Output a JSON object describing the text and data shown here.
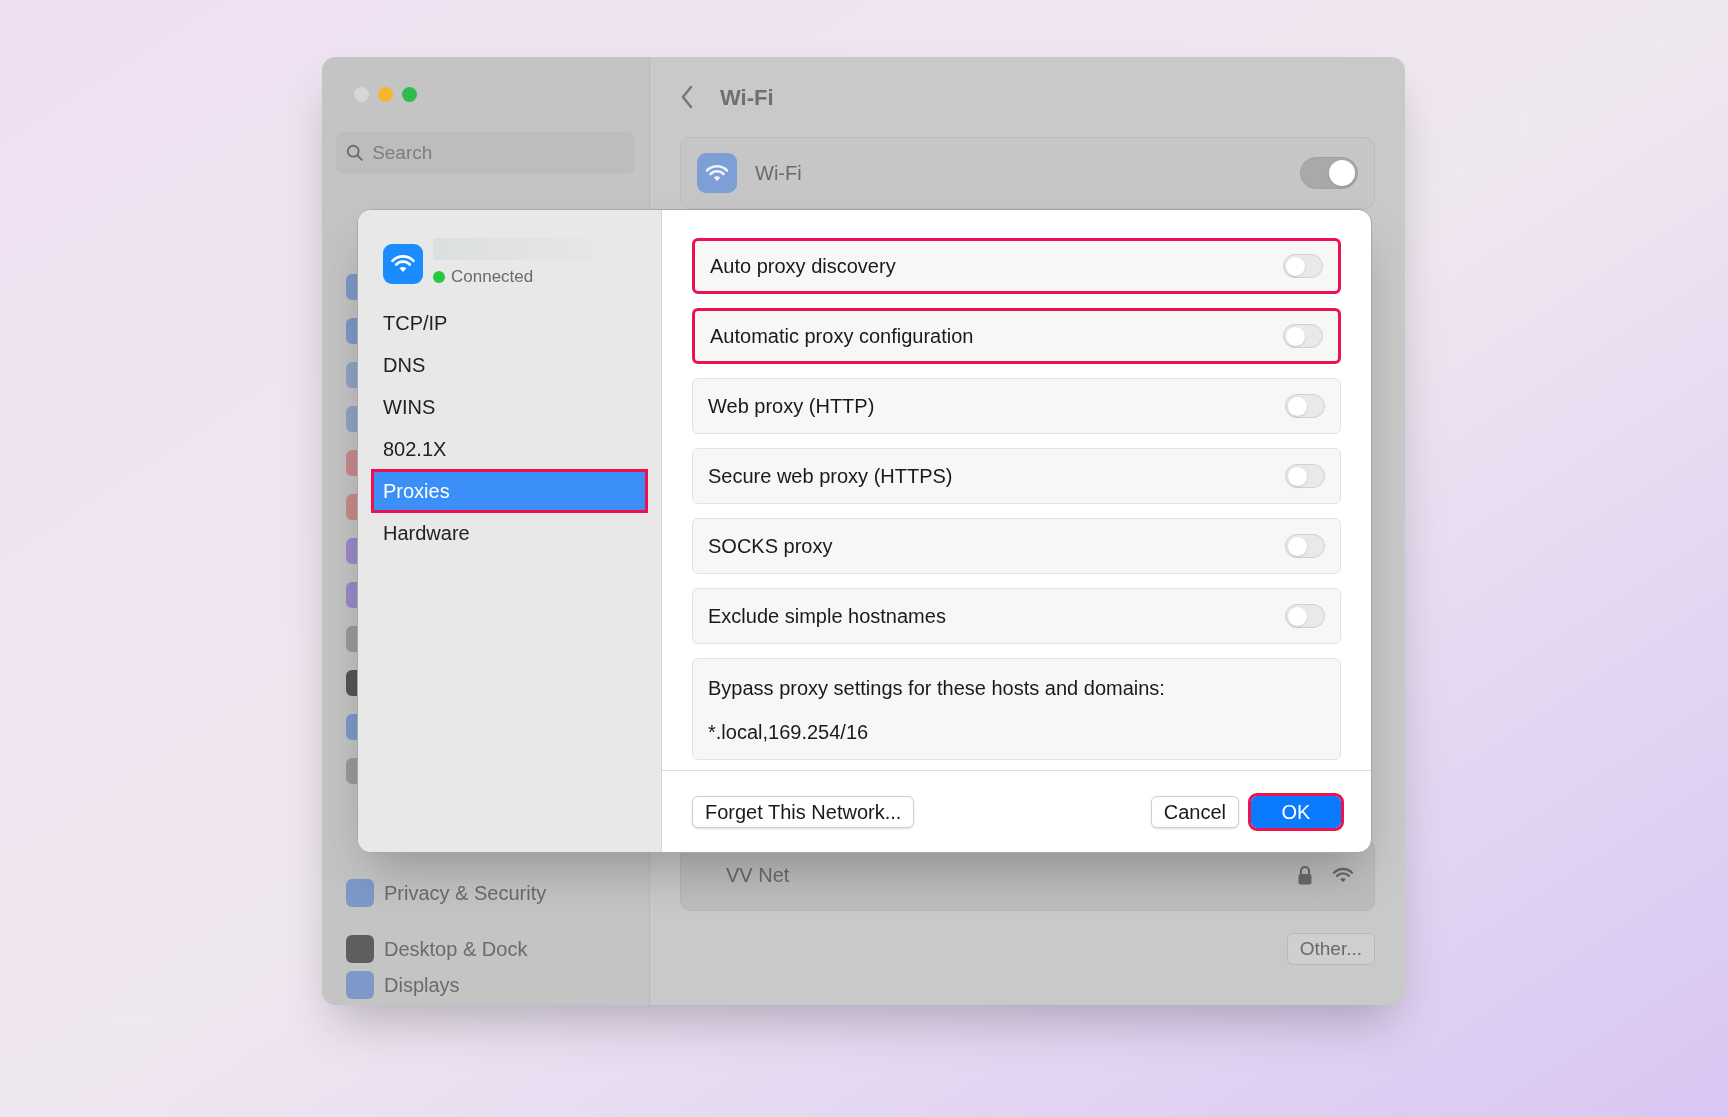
{
  "window": {
    "title": "Wi-Fi"
  },
  "sidebar": {
    "search": {
      "placeholder": "Search"
    },
    "items": [
      {
        "label": "Privacy & Security"
      },
      {
        "label": "Desktop & Dock"
      },
      {
        "label": "Displays"
      }
    ]
  },
  "wifi_panel": {
    "label": "Wi-Fi",
    "on": true
  },
  "networks": [
    {
      "name": "VV Net",
      "locked": true
    }
  ],
  "other_button": "Other...",
  "dialog": {
    "status": "Connected",
    "tabs": [
      {
        "label": "TCP/IP",
        "selected": false,
        "highlighted": false
      },
      {
        "label": "DNS",
        "selected": false,
        "highlighted": false
      },
      {
        "label": "WINS",
        "selected": false,
        "highlighted": false
      },
      {
        "label": "802.1X",
        "selected": false,
        "highlighted": false
      },
      {
        "label": "Proxies",
        "selected": true,
        "highlighted": true
      },
      {
        "label": "Hardware",
        "selected": false,
        "highlighted": false
      }
    ],
    "settings": [
      {
        "label": "Auto proxy discovery",
        "on": false,
        "highlighted": true
      },
      {
        "label": "Automatic proxy configuration",
        "on": false,
        "highlighted": true
      },
      {
        "label": "Web proxy (HTTP)",
        "on": false,
        "highlighted": false
      },
      {
        "label": "Secure web proxy (HTTPS)",
        "on": false,
        "highlighted": false
      },
      {
        "label": "SOCKS proxy",
        "on": false,
        "highlighted": false
      },
      {
        "label": "Exclude simple hostnames",
        "on": false,
        "highlighted": false
      }
    ],
    "bypass": {
      "label": "Bypass proxy settings for these hosts and domains:",
      "value": "*.local,169.254/16"
    },
    "buttons": [
      {
        "label": "Forget This Network...",
        "kind": "secondary",
        "highlighted": false
      },
      {
        "label": "Cancel",
        "kind": "secondary",
        "highlighted": false
      },
      {
        "label": "OK",
        "kind": "primary",
        "highlighted": true
      }
    ]
  }
}
